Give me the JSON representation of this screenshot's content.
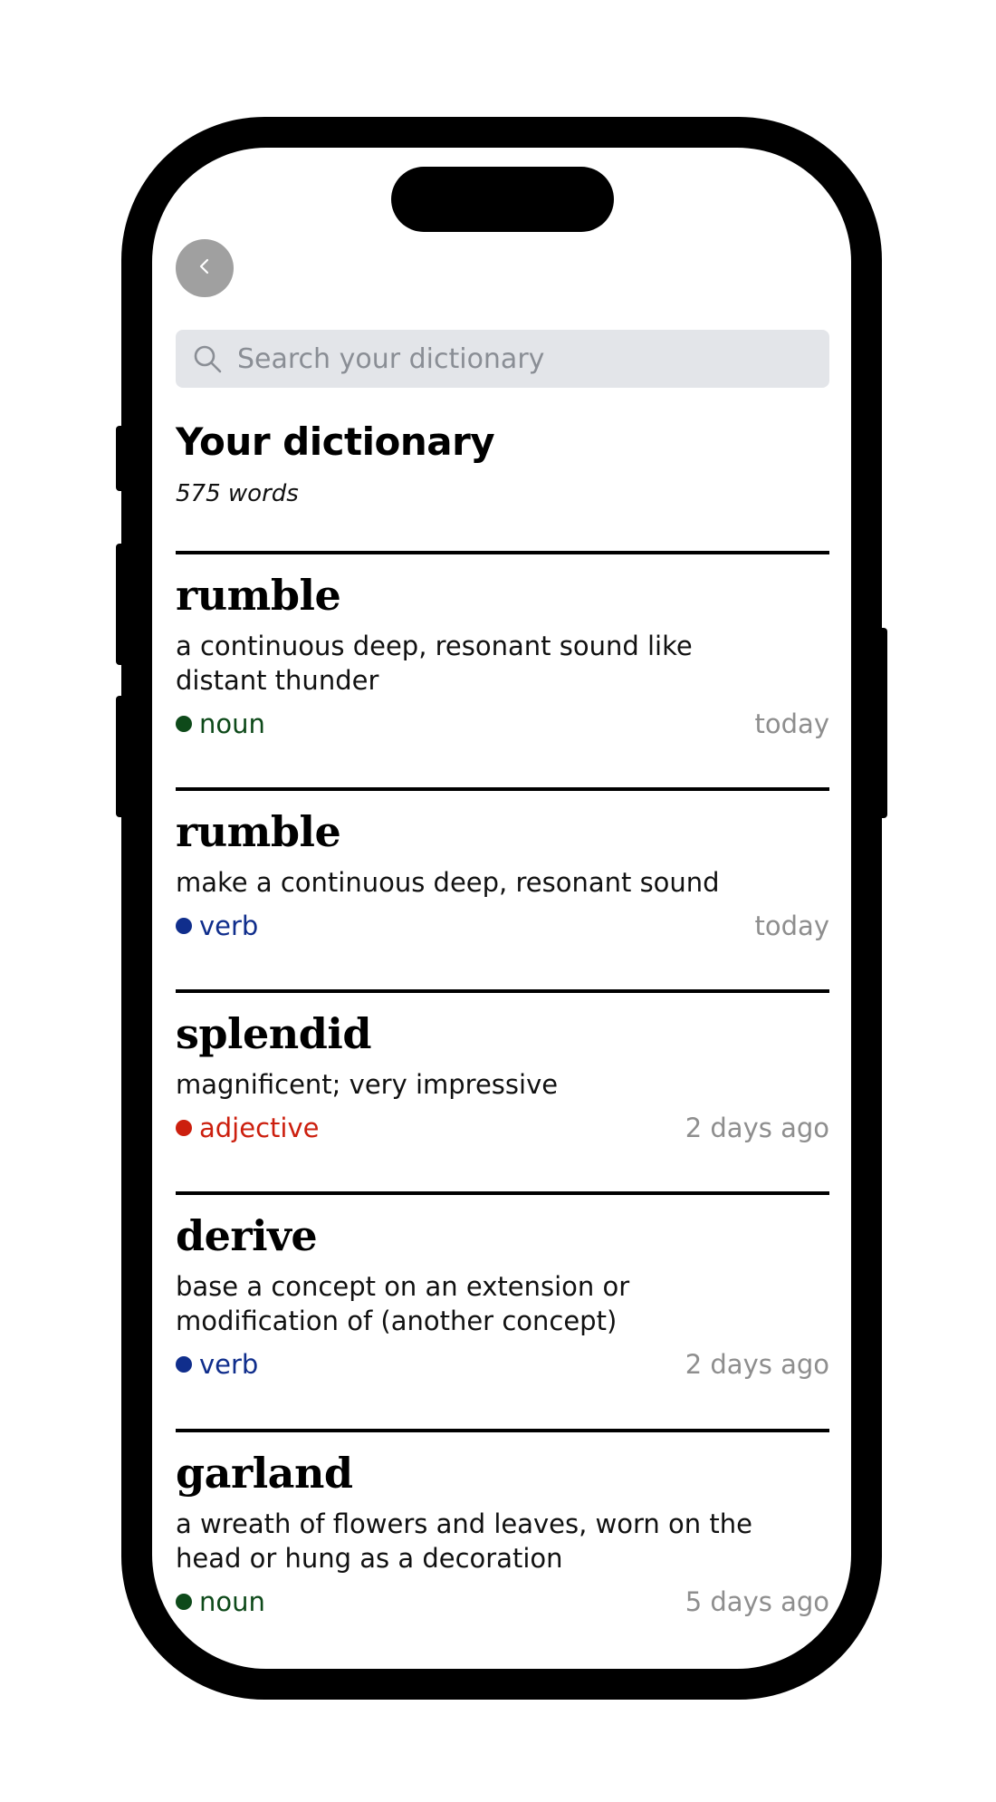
{
  "search": {
    "placeholder": "Search your dictionary",
    "icon": "search-icon"
  },
  "back_button": {
    "icon": "chevron-left-icon"
  },
  "header": {
    "title": "Your dictionary",
    "count": "575 words"
  },
  "colors": {
    "noun": "#0e4a1a",
    "verb": "#102e8c",
    "adjective": "#cc1f0e",
    "timestamp": "#8e8e8e",
    "search_bg": "#e3e5e9"
  },
  "entries": [
    {
      "word": "rumble",
      "definition": "a continuous deep, resonant sound like distant thunder",
      "pos": "noun",
      "added": "today"
    },
    {
      "word": "rumble",
      "definition": "make a continuous deep, resonant sound",
      "pos": "verb",
      "added": "today"
    },
    {
      "word": "splendid",
      "definition": "magnificent; very impressive",
      "pos": "adjective",
      "added": "2 days ago"
    },
    {
      "word": "derive",
      "definition": "base a concept on an extension or modification of (another concept)",
      "pos": "verb",
      "added": "2 days ago"
    },
    {
      "word": "garland",
      "definition": "a wreath of flowers and leaves, worn on the head or hung as a decoration",
      "pos": "noun",
      "added": "5 days ago"
    }
  ]
}
